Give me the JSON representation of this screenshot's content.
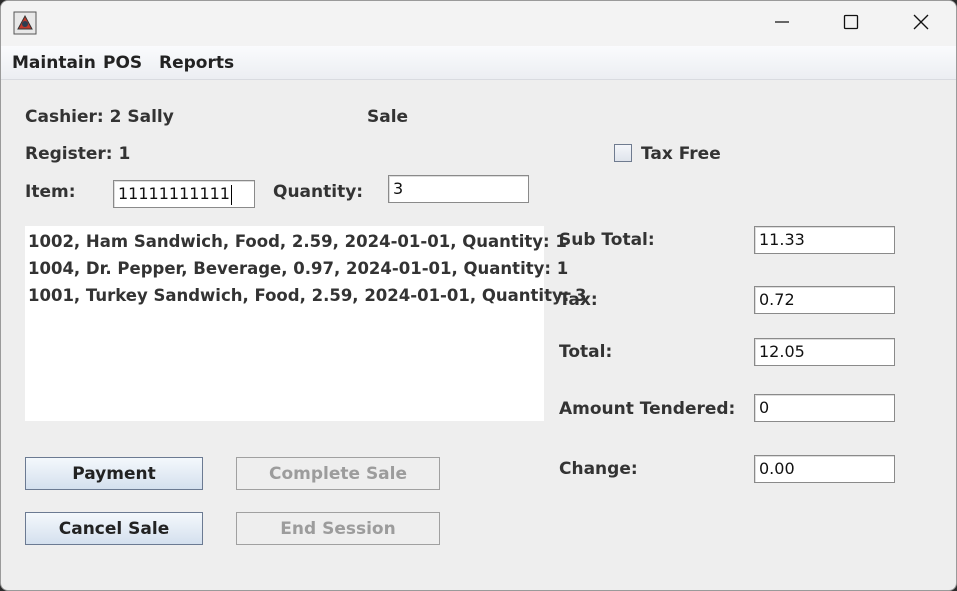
{
  "menubar": {
    "items": [
      "Maintain",
      "POS",
      "Reports"
    ]
  },
  "header": {
    "cashier": "Cashier: 2 Sally",
    "mode": "Sale",
    "register": "Register: 1",
    "tax_free_label": "Tax Free"
  },
  "entry": {
    "item_label": "Item:",
    "item_value": "11111111111",
    "quantity_label": "Quantity:",
    "quantity_value": "3"
  },
  "items": [
    "1002, Ham Sandwich, Food, 2.59, 2024-01-01, Quantity: 1",
    "1004, Dr. Pepper, Beverage, 0.97, 2024-01-01, Quantity: 1",
    "1001, Turkey Sandwich, Food, 2.59, 2024-01-01, Quantity: 3"
  ],
  "totals": {
    "subtotal_label": "Sub Total:",
    "subtotal_value": "11.33",
    "tax_label": "Tax:",
    "tax_value": "0.72",
    "total_label": "Total:",
    "total_value": "12.05",
    "tendered_label": "Amount Tendered:",
    "tendered_value": "0",
    "change_label": "Change:",
    "change_value": "0.00"
  },
  "buttons": {
    "payment": "Payment",
    "complete_sale": "Complete Sale",
    "cancel_sale": "Cancel Sale",
    "end_session": "End Session"
  },
  "icons": {
    "app": "java-app-icon",
    "minimize": "minimize-icon",
    "maximize": "maximize-icon",
    "close": "close-icon"
  }
}
